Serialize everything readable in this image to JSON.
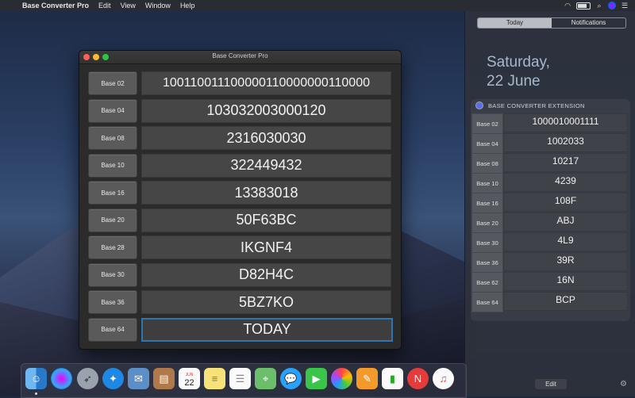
{
  "menubar": {
    "apple": "",
    "app_name": "Base Converter Pro",
    "items": [
      "Edit",
      "View",
      "Window",
      "Help"
    ]
  },
  "window": {
    "title": "Base Converter Pro",
    "rows": [
      {
        "base": "Base 02",
        "value": "100110011100000110000000110000"
      },
      {
        "base": "Base 04",
        "value": "103032003000120"
      },
      {
        "base": "Base 08",
        "value": "2316030030"
      },
      {
        "base": "Base 10",
        "value": "322449432"
      },
      {
        "base": "Base 16",
        "value": "13383018"
      },
      {
        "base": "Base 20",
        "value": "50F63BC"
      },
      {
        "base": "Base 28",
        "value": "IKGNF4"
      },
      {
        "base": "Base 30",
        "value": "D82H4C"
      },
      {
        "base": "Base 36",
        "value": "5BZ7KO"
      },
      {
        "base": "Base 64",
        "value": "TODAY"
      }
    ]
  },
  "notification_center": {
    "tabs": [
      "Today",
      "Notifications"
    ],
    "active_tab": "Today",
    "day": "Saturday,",
    "date": "22 June",
    "extension_title": "BASE CONVERTER EXTENSION",
    "rows": [
      {
        "base": "Base 02",
        "value": "1000010001111"
      },
      {
        "base": "Base 04",
        "value": "1002033"
      },
      {
        "base": "Base 08",
        "value": "10217"
      },
      {
        "base": "Base 10",
        "value": "4239"
      },
      {
        "base": "Base 16",
        "value": "108F"
      },
      {
        "base": "Base 20",
        "value": "ABJ"
      },
      {
        "base": "Base 30",
        "value": "4L9"
      },
      {
        "base": "Base 36",
        "value": "39R"
      },
      {
        "base": "Base 62",
        "value": "16N"
      },
      {
        "base": "Base 64",
        "value": "BCP"
      }
    ],
    "edit_label": "Edit"
  },
  "dock": {
    "calendar_day": "22",
    "calendar_month": "JUN",
    "icons": [
      "finder-icon",
      "siri-icon",
      "launchpad-icon",
      "safari-icon",
      "mail-icon",
      "contacts-icon",
      "calendar-icon",
      "notes-icon",
      "reminders-icon",
      "maps-icon",
      "messages-icon",
      "facetime-icon",
      "photos-icon",
      "pages-icon",
      "numbers-icon",
      "news-icon",
      "music-icon"
    ]
  },
  "colors": {
    "focus_ring": "#2f76b0",
    "close": "#fc5f57",
    "minimize": "#fdbc2e",
    "zoom": "#28c840"
  }
}
